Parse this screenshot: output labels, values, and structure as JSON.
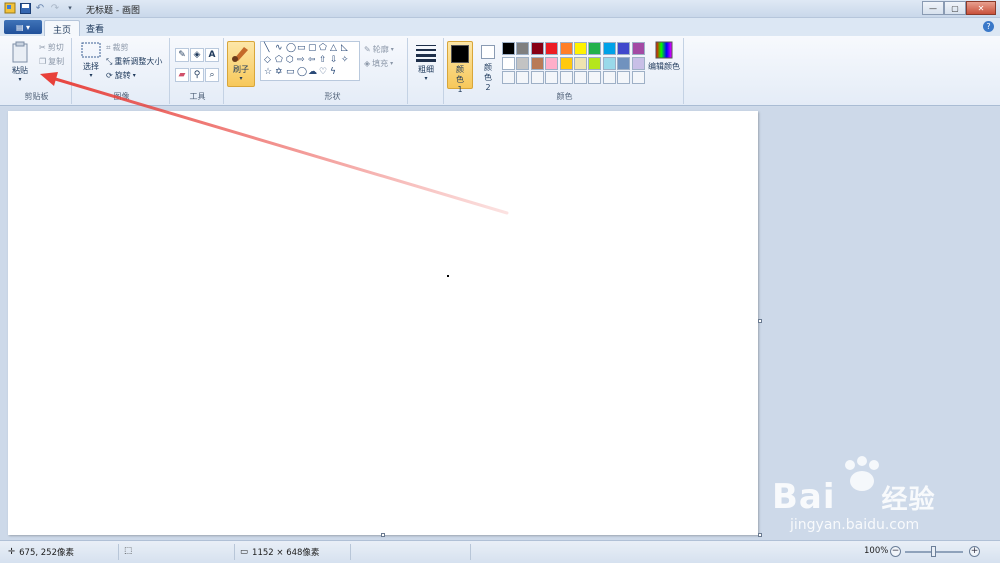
{
  "window": {
    "title": "无标题 - 画图",
    "controls": [
      "—",
      "▢",
      "✕"
    ]
  },
  "tabs": [
    {
      "label": "主页",
      "active": true
    },
    {
      "label": "查看",
      "active": false
    }
  ],
  "ribbon": {
    "clipboard": {
      "label": "剪贴板",
      "paste": "粘贴",
      "cut": "剪切",
      "copy": "复制"
    },
    "image": {
      "label": "图像",
      "select": "选择",
      "crop": "裁剪",
      "resize": "重新调整大小",
      "rotate": "旋转"
    },
    "tools": {
      "label": "工具",
      "icons": [
        "pencil-icon",
        "fill-icon",
        "text-icon",
        "eraser-icon",
        "color-picker-icon",
        "magnifier-icon"
      ]
    },
    "brushes": {
      "label": "刷子"
    },
    "shapes": {
      "label": "形状",
      "outline": "轮廓",
      "fill": "填充"
    },
    "size": {
      "label": "粗细"
    },
    "colors": {
      "label": "颜色",
      "color1": "颜色 1",
      "color2": "颜色 2",
      "edit": "编辑颜色",
      "palette_row1": [
        "#000000",
        "#7f7f7f",
        "#880015",
        "#ed1c24",
        "#ff7f27",
        "#fff200",
        "#22b14c",
        "#00a2e8",
        "#3f48cc",
        "#a349a4"
      ],
      "palette_row2": [
        "#ffffff",
        "#c3c3c3",
        "#b97a57",
        "#ffaec9",
        "#ffc90e",
        "#efe4b0",
        "#b5e61d",
        "#99d9ea",
        "#7092be",
        "#c8bfe7"
      ]
    }
  },
  "statusbar": {
    "cursor_position": "675, 252像素",
    "image_size": "1152 × 648像素",
    "zoom": "100%"
  },
  "watermark": {
    "brand": "Bai",
    "brand2": "经验",
    "url": "jingyan.baidu.com"
  },
  "annotation": {
    "color": "#e8403a"
  }
}
